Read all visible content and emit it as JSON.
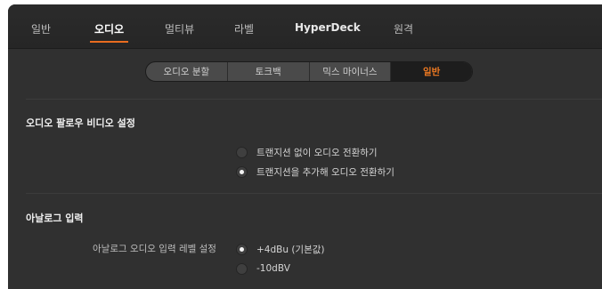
{
  "tabs": [
    {
      "label": "일반",
      "active": false
    },
    {
      "label": "오디오",
      "active": true
    },
    {
      "label": "멀티뷰",
      "active": false
    },
    {
      "label": "라벨",
      "active": false
    },
    {
      "label": "HyperDeck",
      "active": false
    },
    {
      "label": "원격",
      "active": false
    }
  ],
  "subtabs": [
    {
      "label": "오디오 분할",
      "active": false
    },
    {
      "label": "토크백",
      "active": false
    },
    {
      "label": "믹스 마이너스",
      "active": false
    },
    {
      "label": "일반",
      "active": true
    }
  ],
  "audio_follow_video": {
    "title": "오디오 팔로우 비디오 설정",
    "options": [
      {
        "label": "트랜지션 없이 오디오 전환하기",
        "selected": false
      },
      {
        "label": "트랜지션을 추가해 오디오 전환하기",
        "selected": true
      }
    ]
  },
  "analog_input": {
    "title": "아날로그 입력",
    "level_label": "아날로그 오디오 입력 레벨 설정",
    "options": [
      {
        "label": "+4dBu (기본값)",
        "selected": true
      },
      {
        "label": "-10dBV",
        "selected": false
      }
    ]
  },
  "colors": {
    "accent": "#ea6c1f",
    "background": "#303030",
    "topbar": "#262626"
  }
}
